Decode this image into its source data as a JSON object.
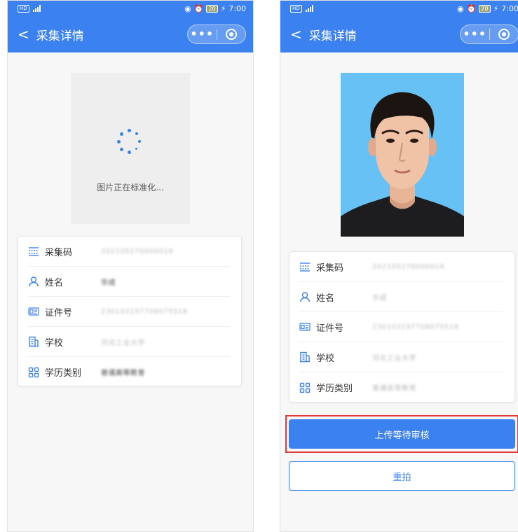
{
  "status": {
    "time": "7:00",
    "battery": "20",
    "network": "HD"
  },
  "nav": {
    "back_glyph": "<",
    "title": "采集详情",
    "more_glyph": "•••"
  },
  "loading": {
    "text": "图片正在标准化..."
  },
  "info": {
    "rows": [
      {
        "label": "采集码",
        "value": "202105270000019",
        "icon": "barcode-icon"
      },
      {
        "label": "姓名",
        "value": "华成",
        "icon": "person-icon"
      },
      {
        "label": "证件号",
        "value": "230103197708075518",
        "icon": "id-card-icon"
      },
      {
        "label": "学校",
        "value": "河北工业大学",
        "icon": "building-icon"
      },
      {
        "label": "学历类别",
        "value": "普通高等教育",
        "icon": "grid-icon"
      }
    ]
  },
  "actions": {
    "upload_label": "上传等待审核",
    "retake_label": "重拍"
  },
  "colors": {
    "accent": "#3b82f0",
    "photo_bg": "#67c1f5",
    "highlight": "#e03a3a"
  }
}
